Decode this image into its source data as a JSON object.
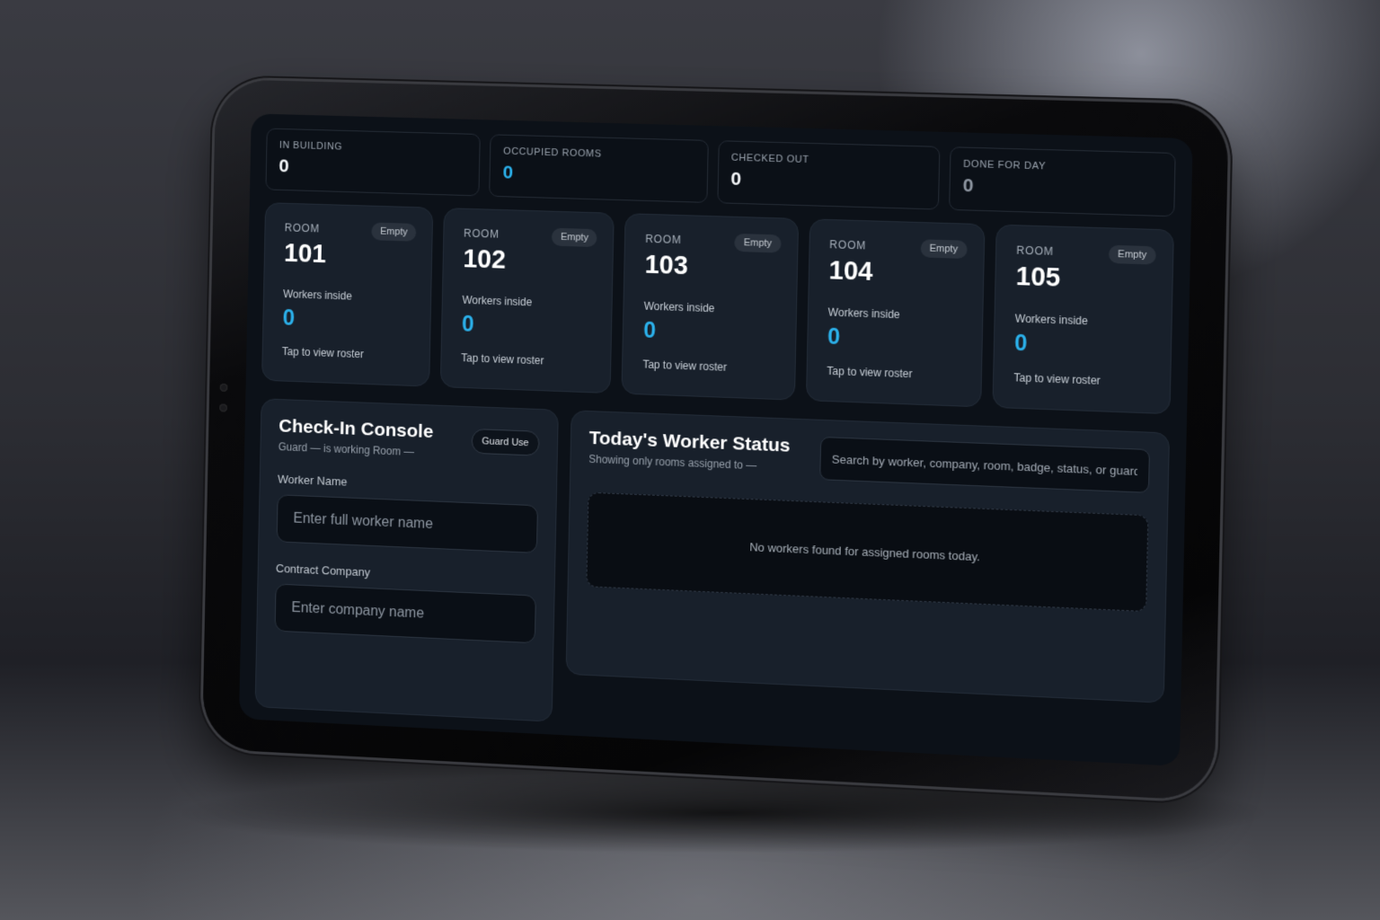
{
  "stats": [
    {
      "label": "IN BUILDING",
      "value": "0",
      "tone": "white"
    },
    {
      "label": "OCCUPIED ROOMS",
      "value": "0",
      "tone": "accent"
    },
    {
      "label": "CHECKED OUT",
      "value": "0",
      "tone": "white"
    },
    {
      "label": "DONE FOR DAY",
      "value": "0",
      "tone": "muted"
    }
  ],
  "rooms": [
    {
      "label": "ROOM",
      "number": "101",
      "badge": "Empty",
      "workers_label": "Workers inside",
      "workers": "0",
      "tap": "Tap to view roster"
    },
    {
      "label": "ROOM",
      "number": "102",
      "badge": "Empty",
      "workers_label": "Workers inside",
      "workers": "0",
      "tap": "Tap to view roster"
    },
    {
      "label": "ROOM",
      "number": "103",
      "badge": "Empty",
      "workers_label": "Workers inside",
      "workers": "0",
      "tap": "Tap to view roster"
    },
    {
      "label": "ROOM",
      "number": "104",
      "badge": "Empty",
      "workers_label": "Workers inside",
      "workers": "0",
      "tap": "Tap to view roster"
    },
    {
      "label": "ROOM",
      "number": "105",
      "badge": "Empty",
      "workers_label": "Workers inside",
      "workers": "0",
      "tap": "Tap to view roster"
    }
  ],
  "console": {
    "title": "Check-In Console",
    "subtitle": "Guard — is working Room —",
    "badge": "Guard Use",
    "worker_label": "Worker Name",
    "worker_placeholder": "Enter full worker name",
    "company_label": "Contract Company",
    "company_placeholder": "Enter company name"
  },
  "status": {
    "title": "Today's Worker Status",
    "subtitle": "Showing only rooms assigned to —",
    "search_placeholder": "Search by worker, company, room, badge, status, or guard",
    "empty_text": "No workers found for assigned rooms today."
  },
  "colors": {
    "accent": "#2bb0ea",
    "screen_bg": "#0c1118",
    "card_bg": "#18202b"
  }
}
